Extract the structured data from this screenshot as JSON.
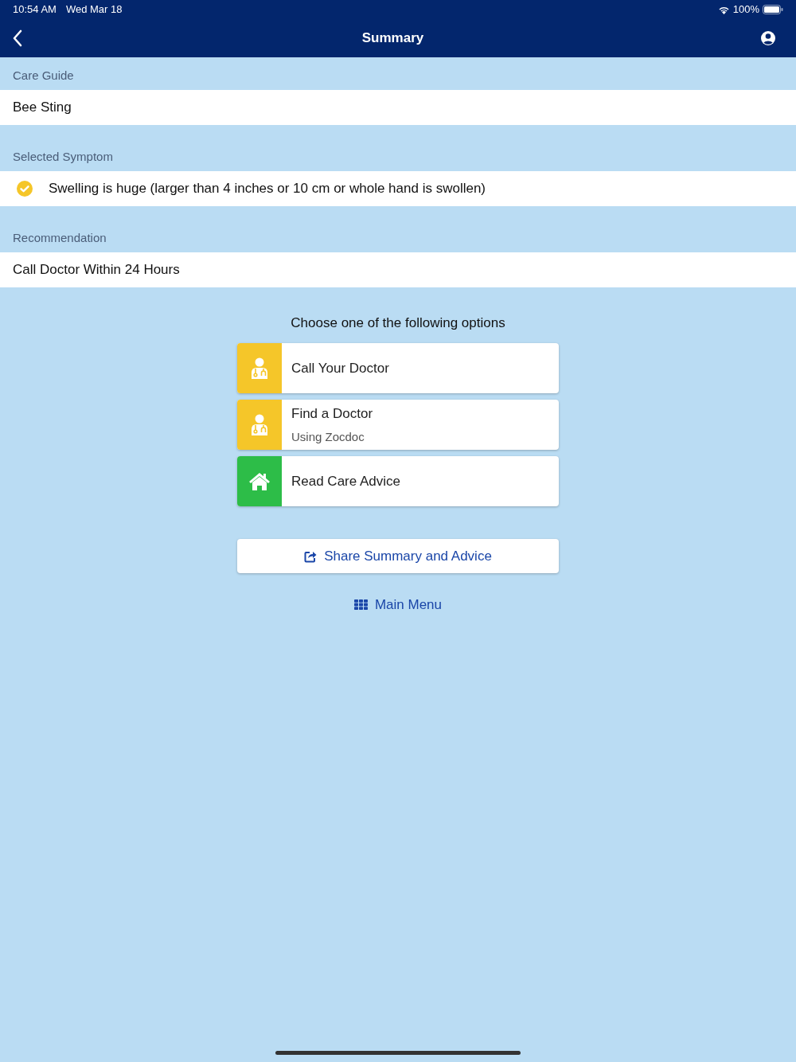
{
  "status_bar": {
    "time": "10:54 AM",
    "date": "Wed Mar 18",
    "battery": "100%"
  },
  "nav_bar": {
    "title": "Summary"
  },
  "sections": [
    {
      "kind": "plain",
      "label": "Care Guide",
      "value": "Bee Sting"
    },
    {
      "kind": "symptom",
      "label": "Selected Symptom",
      "value": "Swelling is huge (larger than 4 inches or 10 cm or whole hand is swollen)",
      "checked": true
    },
    {
      "kind": "plain",
      "label": "Recommendation",
      "value": "Call Doctor Within 24 Hours"
    }
  ],
  "options_prompt": "Choose one of the following options",
  "options": [
    {
      "kind": "doctor",
      "color": "#f5c629",
      "title": "Call Your Doctor"
    },
    {
      "kind": "doctor",
      "color": "#f5c629",
      "title": "Find a Doctor",
      "subtitle": "Using Zocdoc"
    },
    {
      "kind": "home",
      "color": "#2dbd48",
      "title": "Read Care Advice"
    }
  ],
  "share_button": "Share Summary and Advice",
  "main_menu_link": "Main Menu"
}
